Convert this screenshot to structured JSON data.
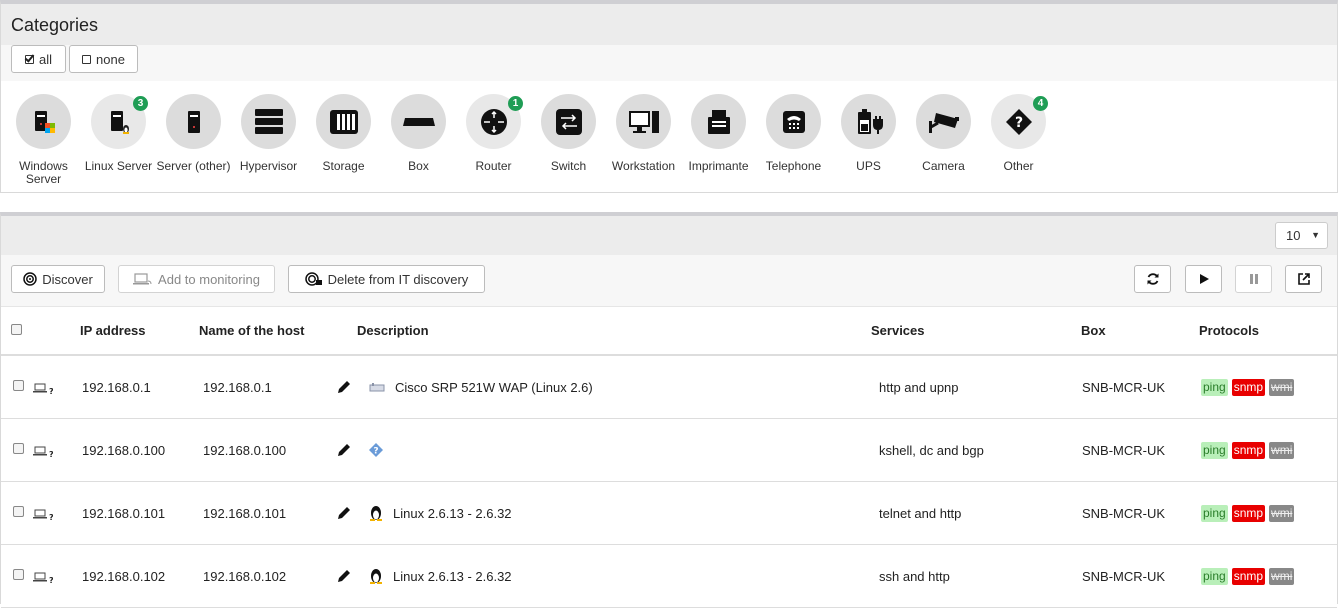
{
  "categories_panel": {
    "title": "Categories",
    "all_label": "all",
    "none_label": "none",
    "items": [
      {
        "label": "Windows Server",
        "badge": ""
      },
      {
        "label": "Linux Server",
        "badge": "3"
      },
      {
        "label": "Server (other)",
        "badge": ""
      },
      {
        "label": "Hypervisor",
        "badge": ""
      },
      {
        "label": "Storage",
        "badge": ""
      },
      {
        "label": "Box",
        "badge": ""
      },
      {
        "label": "Router",
        "badge": "1"
      },
      {
        "label": "Switch",
        "badge": ""
      },
      {
        "label": "Workstation",
        "badge": ""
      },
      {
        "label": "Imprimante",
        "badge": ""
      },
      {
        "label": "Telephone",
        "badge": ""
      },
      {
        "label": "UPS",
        "badge": ""
      },
      {
        "label": "Camera",
        "badge": ""
      },
      {
        "label": "Other",
        "badge": "4"
      }
    ]
  },
  "hosts_panel": {
    "page_size": "10",
    "discover_label": "Discover",
    "add_monitoring_label": "Add to monitoring",
    "delete_label": "Delete from IT discovery",
    "columns": [
      "IP address",
      "Name of the host",
      "Description",
      "Services",
      "Box",
      "Protocols"
    ],
    "rows": [
      {
        "ip": "192.168.0.1",
        "host": "192.168.0.1",
        "os_icon": "device-icon",
        "description": "Cisco SRP 521W WAP (Linux 2.6)",
        "services": "http and upnp",
        "box": "SNB-MCR-UK",
        "protocols": [
          "ping",
          "snmp",
          "wmi"
        ]
      },
      {
        "ip": "192.168.0.100",
        "host": "192.168.0.100",
        "os_icon": "unknown-os-icon",
        "description": "",
        "services": "kshell, dc and bgp",
        "box": "SNB-MCR-UK",
        "protocols": [
          "ping",
          "snmp",
          "wmi"
        ]
      },
      {
        "ip": "192.168.0.101",
        "host": "192.168.0.101",
        "os_icon": "linux-icon",
        "description": "Linux 2.6.13 - 2.6.32",
        "services": "telnet and http",
        "box": "SNB-MCR-UK",
        "protocols": [
          "ping",
          "snmp",
          "wmi"
        ]
      },
      {
        "ip": "192.168.0.102",
        "host": "192.168.0.102",
        "os_icon": "linux-icon",
        "description": "Linux 2.6.13 - 2.6.32",
        "services": "ssh and http",
        "box": "SNB-MCR-UK",
        "protocols": [
          "ping",
          "snmp",
          "wmi"
        ]
      }
    ]
  },
  "colors": {
    "badge": "#1f9d55",
    "snmp": "#e80000",
    "ping": "#b9efb9",
    "wmi": "#888888"
  }
}
